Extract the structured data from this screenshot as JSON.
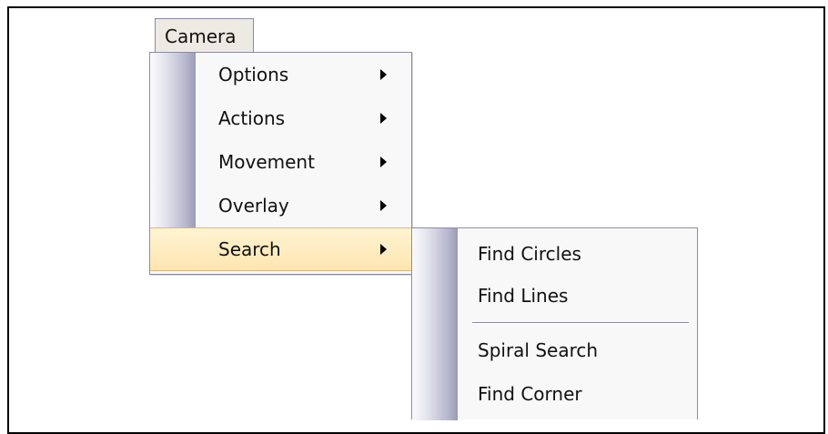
{
  "menubar": {
    "title": "Camera"
  },
  "menu": {
    "items": [
      {
        "label": "Options",
        "has_submenu": true
      },
      {
        "label": "Actions",
        "has_submenu": true
      },
      {
        "label": "Movement",
        "has_submenu": true
      },
      {
        "label": "Overlay",
        "has_submenu": true
      },
      {
        "label": "Search",
        "has_submenu": true,
        "highlighted": true
      }
    ]
  },
  "submenu": {
    "items": [
      {
        "label": "Find Circles"
      },
      {
        "label": "Find Lines"
      },
      {
        "label": "Spiral Search"
      },
      {
        "label": "Find Corner"
      }
    ]
  },
  "colors": {
    "highlight": "#fde5b0",
    "border": "#8c8ca6",
    "gutter": "#9b9bb6"
  }
}
